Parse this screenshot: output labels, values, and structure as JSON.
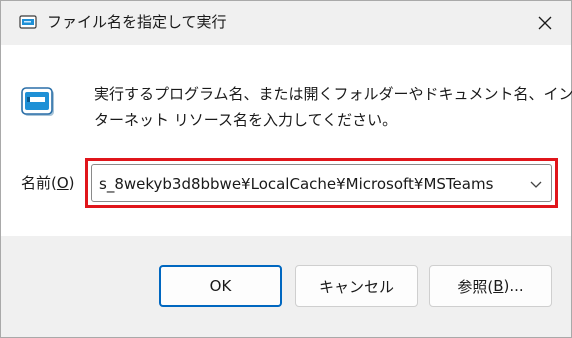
{
  "window": {
    "title": "ファイル名を指定して実行",
    "close_icon": "close-icon",
    "title_icon": "run-dialog-icon"
  },
  "description": {
    "line1": "実行するプログラム名、または開くフォルダーやドキュメント名、イン",
    "line2": "ターネット リソース名を入力してください。"
  },
  "name_field": {
    "label_prefix": "名前(",
    "label_accel": "O",
    "label_suffix": ")",
    "value": "s_8wekyb3d8bbwe¥LocalCache¥Microsoft¥MSTeams",
    "dropdown_icon": "chevron-down-icon",
    "highlight_color": "#e0151b"
  },
  "buttons": {
    "ok_label": "OK",
    "cancel_label": "キャンセル",
    "browse_prefix": "参照(",
    "browse_accel": "B",
    "browse_suffix": ")..."
  },
  "colors": {
    "accent": "#0067c0",
    "icon_blue": "#1e90d6"
  }
}
